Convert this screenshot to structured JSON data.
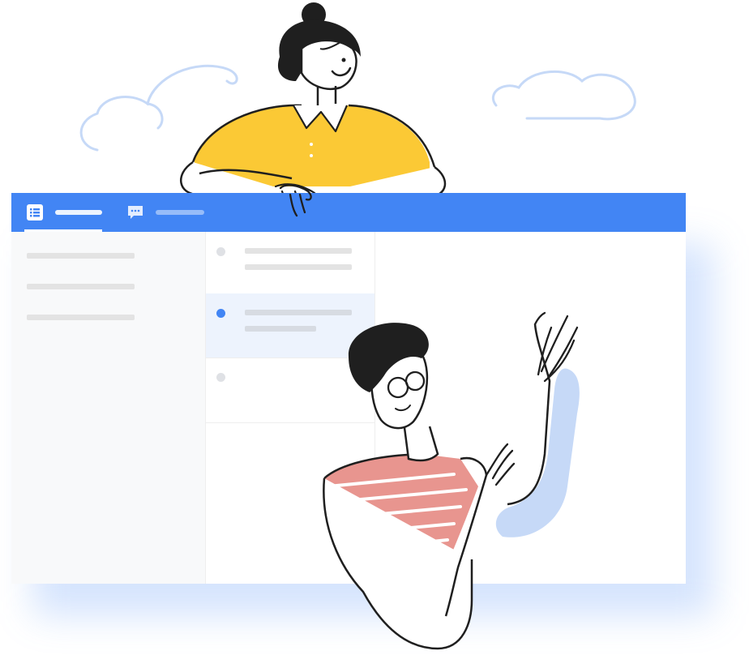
{
  "app": {
    "tabs": [
      {
        "icon": "list-icon",
        "label": "",
        "active": true
      },
      {
        "icon": "chat-icon",
        "label": "",
        "active": false
      }
    ],
    "sidebar": {
      "items": [
        {
          "label": ""
        },
        {
          "label": ""
        },
        {
          "label": ""
        }
      ]
    },
    "list": {
      "items": [
        {
          "title": "",
          "subtitle": "",
          "selected": false
        },
        {
          "title": "",
          "subtitle": "",
          "selected": true
        },
        {
          "title": "",
          "subtitle": "",
          "selected": false
        }
      ]
    }
  },
  "illustration": {
    "figures": [
      "woman-leaning-on-window",
      "man-waving"
    ],
    "decor": [
      "cloud-left",
      "cloud-right"
    ]
  },
  "colors": {
    "accent": "#4285f4",
    "selected_row": "#edf3fd",
    "yellow_shirt": "#fbc935",
    "striped_shirt": "#e8958f",
    "sky_line": "#c6d9f7"
  }
}
